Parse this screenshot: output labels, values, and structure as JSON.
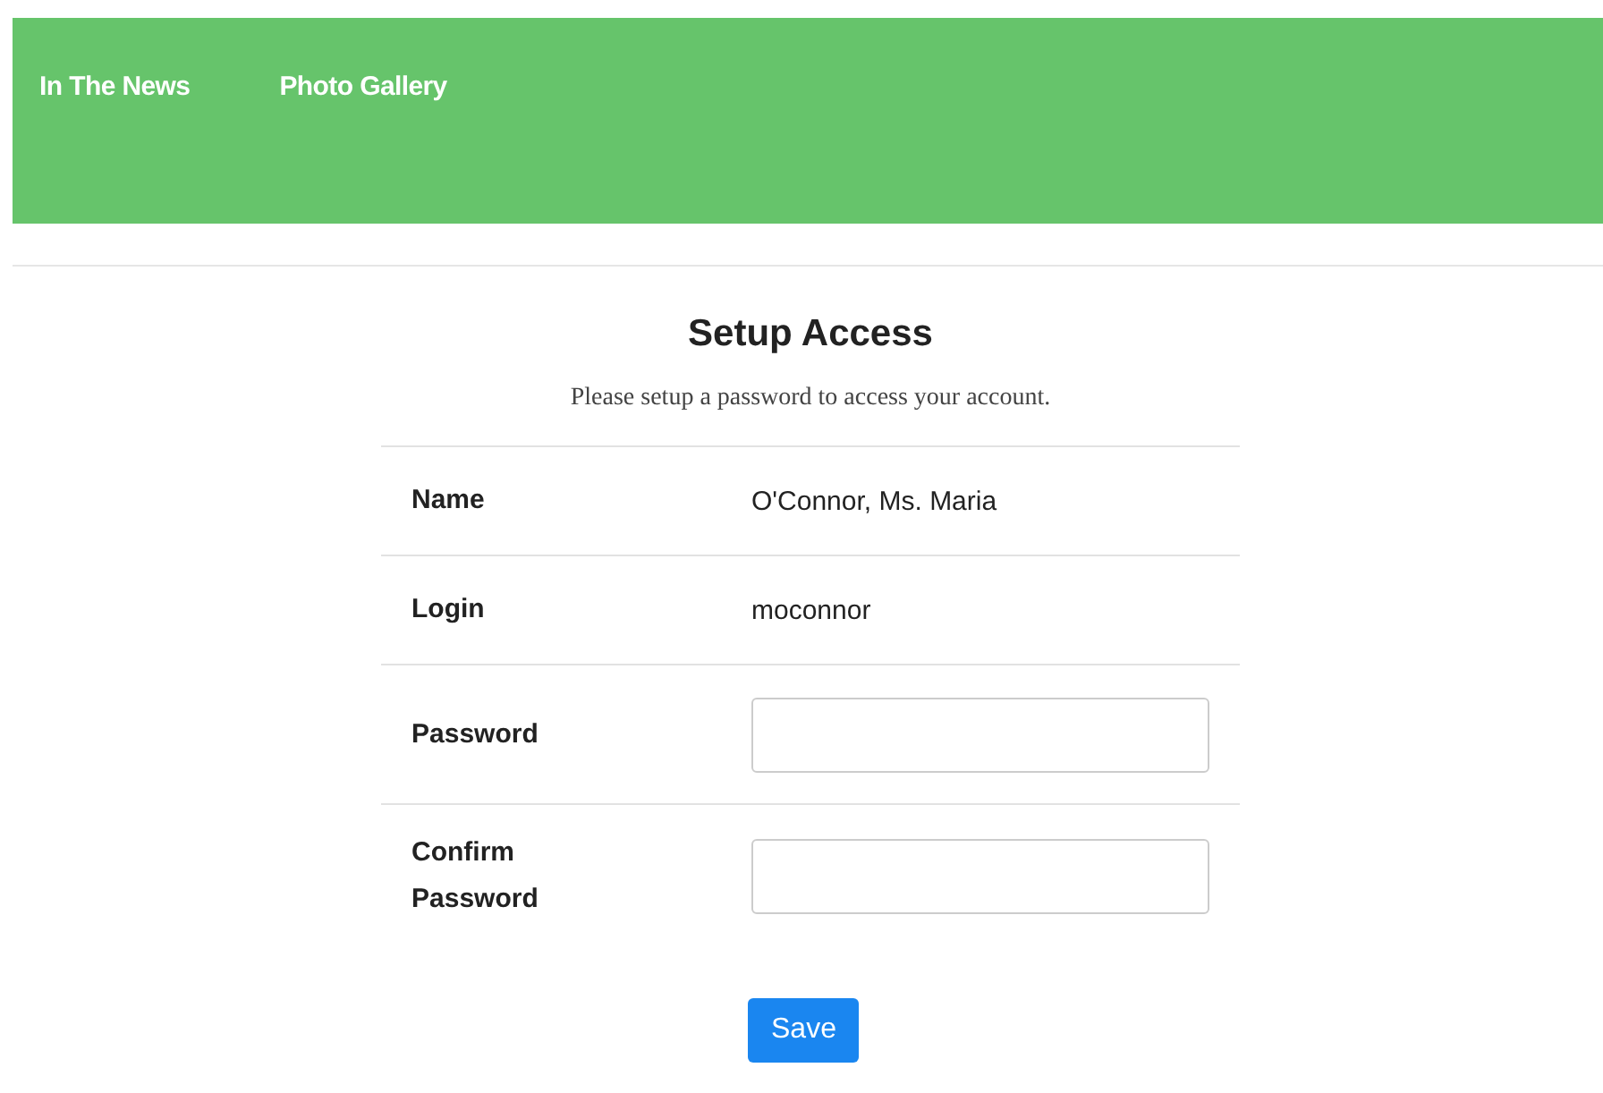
{
  "nav": {
    "links": [
      {
        "label": "In The News"
      },
      {
        "label": "Photo Gallery"
      }
    ]
  },
  "title": "Setup Access",
  "subtitle": "Please setup a password to access your account.",
  "rows": [
    {
      "kind": "text",
      "label": "Name",
      "value": "O'Connor, Ms. Maria"
    },
    {
      "kind": "text",
      "label": "Login",
      "value": "moconnor"
    },
    {
      "kind": "input",
      "label": "Password"
    },
    {
      "kind": "input",
      "label": "Confirm Password"
    }
  ],
  "save_button": "Save"
}
